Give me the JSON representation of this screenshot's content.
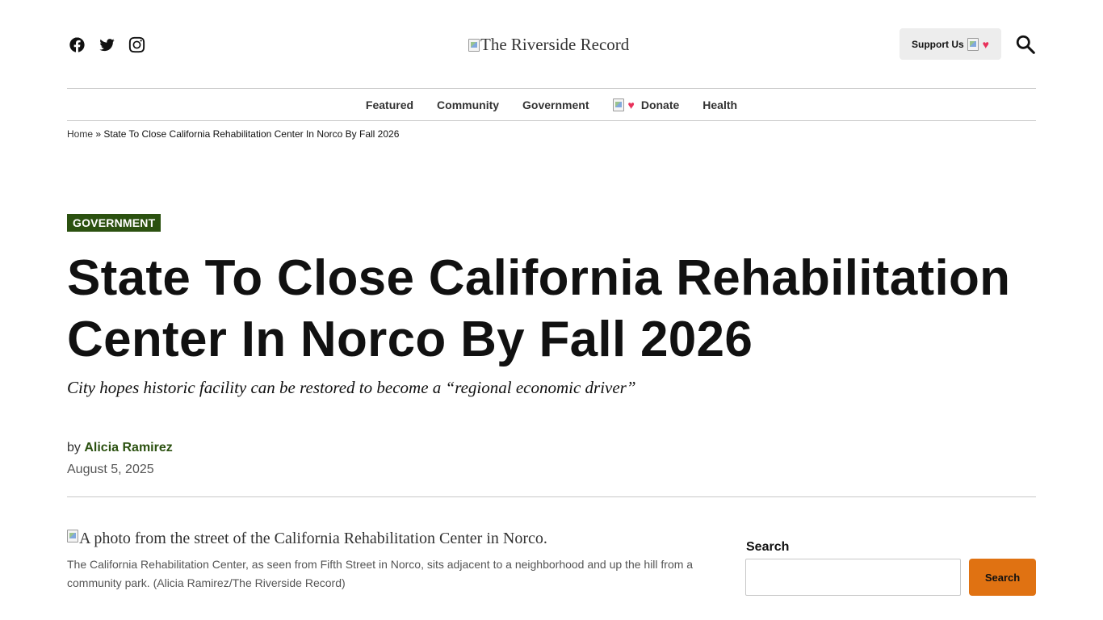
{
  "site": {
    "logo_alt": "The Riverside Record",
    "support_label": "Support Us",
    "social": [
      "facebook-icon",
      "twitter-icon",
      "instagram-icon"
    ]
  },
  "nav": {
    "items": [
      {
        "label": "Featured"
      },
      {
        "label": "Community"
      },
      {
        "label": "Government"
      },
      {
        "label": "Donate"
      },
      {
        "label": "Health"
      }
    ]
  },
  "breadcrumb": {
    "home": "Home",
    "separator": "»",
    "current": "State To Close California Rehabilitation Center In Norco By Fall 2026"
  },
  "article": {
    "category": "GOVERNMENT",
    "title": "State To Close California Rehabilitation Center In Norco By Fall 2026",
    "dek": "City hopes historic facility can be restored to become a “regional economic driver”",
    "by": "by",
    "author": "Alicia Ramirez",
    "date": "August 5, 2025",
    "image_alt": "A photo from the street of the California Rehabilitation Center in Norco.",
    "caption": "The California Rehabilitation Center, as seen from Fifth Street in Norco, sits adjacent to a neighborhood and up the hill from a community park. (Alicia Ramirez/The Riverside Record)"
  },
  "sidebar": {
    "search_label": "Search",
    "search_button": "Search"
  },
  "colors": {
    "category_bg": "#2b5110",
    "author": "#2b5110",
    "search_button": "#e07212",
    "heart": "#e8315a"
  }
}
